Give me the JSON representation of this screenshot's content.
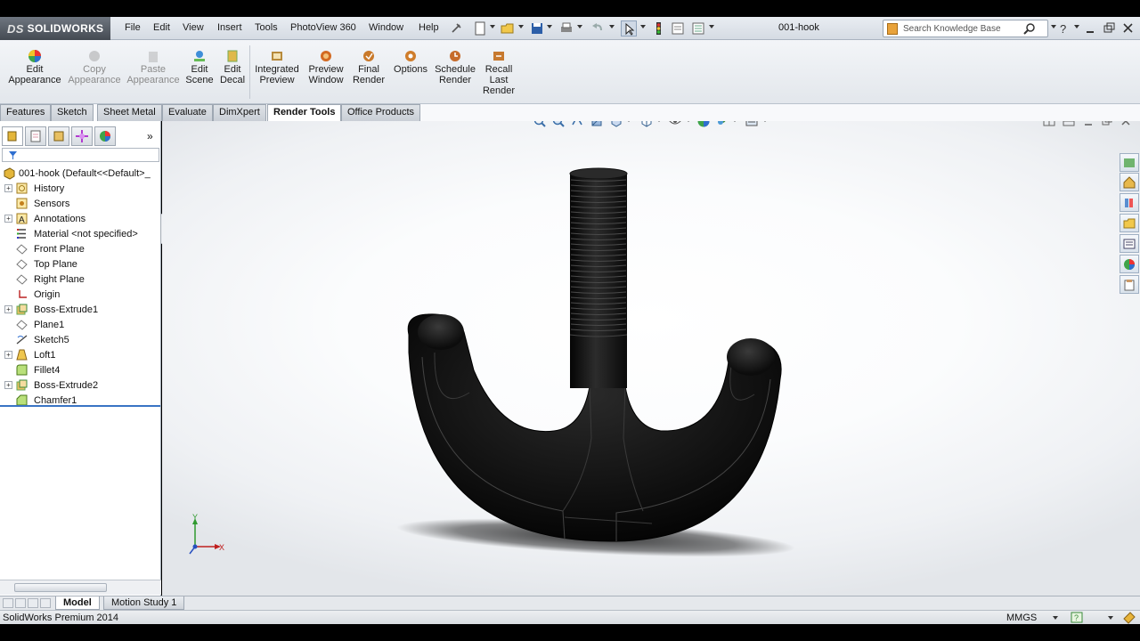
{
  "app": {
    "logo": "SOLIDWORKS",
    "doc_title": "001-hook"
  },
  "menu": [
    "File",
    "Edit",
    "View",
    "Insert",
    "Tools",
    "PhotoView 360",
    "Window",
    "Help"
  ],
  "search": {
    "placeholder": "Search Knowledge Base"
  },
  "commands": [
    {
      "label": "Edit\nAppearance",
      "enabled": true
    },
    {
      "label": "Copy\nAppearance",
      "enabled": false
    },
    {
      "label": "Paste\nAppearance",
      "enabled": false
    },
    {
      "label": "Edit\nScene",
      "enabled": true
    },
    {
      "label": "Edit\nDecal",
      "enabled": true
    },
    {
      "label": "Integrated\nPreview",
      "enabled": true
    },
    {
      "label": "Preview\nWindow",
      "enabled": true
    },
    {
      "label": "Final\nRender",
      "enabled": true
    },
    {
      "label": "Options",
      "enabled": true
    },
    {
      "label": "Schedule\nRender",
      "enabled": true
    },
    {
      "label": "Recall\nLast\nRender",
      "enabled": true
    }
  ],
  "tabs": [
    "Features",
    "Sketch",
    "Sheet Metal",
    "Evaluate",
    "DimXpert",
    "Render Tools",
    "Office Products"
  ],
  "active_tab": "Render Tools",
  "tree": {
    "root": "001-hook  (Default<<Default>_",
    "items": [
      {
        "label": "History",
        "icon": "history-icon",
        "expandable": true
      },
      {
        "label": "Sensors",
        "icon": "sensor-icon",
        "expandable": false
      },
      {
        "label": "Annotations",
        "icon": "annotation-icon",
        "expandable": true
      },
      {
        "label": "Material <not specified>",
        "icon": "material-icon",
        "expandable": false
      },
      {
        "label": "Front Plane",
        "icon": "plane-icon",
        "expandable": false
      },
      {
        "label": "Top Plane",
        "icon": "plane-icon",
        "expandable": false
      },
      {
        "label": "Right Plane",
        "icon": "plane-icon",
        "expandable": false
      },
      {
        "label": "Origin",
        "icon": "origin-icon",
        "expandable": false
      },
      {
        "label": "Boss-Extrude1",
        "icon": "extrude-icon",
        "expandable": true
      },
      {
        "label": "Plane1",
        "icon": "plane-icon",
        "expandable": false
      },
      {
        "label": "Sketch5",
        "icon": "sketch-icon",
        "expandable": false
      },
      {
        "label": "Loft1",
        "icon": "loft-icon",
        "expandable": true
      },
      {
        "label": "Fillet4",
        "icon": "fillet-icon",
        "expandable": false
      },
      {
        "label": "Boss-Extrude2",
        "icon": "extrude-icon",
        "expandable": true
      },
      {
        "label": "Chamfer1",
        "icon": "chamfer-icon",
        "expandable": false
      }
    ]
  },
  "triad": {
    "x": "X",
    "y": "Y"
  },
  "bottom_tabs": [
    "Model",
    "Motion Study 1"
  ],
  "active_bottom_tab": "Model",
  "status": {
    "left": "SolidWorks Premium 2014",
    "units": "MMGS"
  },
  "colors": {
    "accent": "#3a74c4",
    "part": "#1a1a1a"
  }
}
